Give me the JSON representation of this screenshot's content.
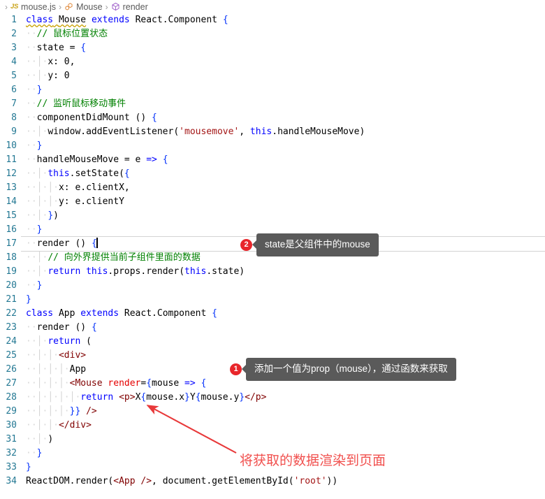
{
  "breadcrumb": {
    "items": [
      {
        "icon": "js-file-icon",
        "label": "mouse.js"
      },
      {
        "icon": "class-symbol-icon",
        "label": "Mouse"
      },
      {
        "icon": "method-symbol-icon",
        "label": "render"
      }
    ],
    "separator": "›"
  },
  "editor": {
    "language": "javascript",
    "current_line": 17,
    "lines": [
      {
        "n": "1",
        "text": "class Mouse extends React.Component {"
      },
      {
        "n": "2",
        "text": "  // 鼠标位置状态"
      },
      {
        "n": "3",
        "text": "  state = {"
      },
      {
        "n": "4",
        "text": "    x: 0,"
      },
      {
        "n": "5",
        "text": "    y: 0"
      },
      {
        "n": "6",
        "text": "  }"
      },
      {
        "n": "7",
        "text": "  // 监听鼠标移动事件"
      },
      {
        "n": "8",
        "text": "  componentDidMount () {"
      },
      {
        "n": "9",
        "text": "    window.addEventListener('mousemove', this.handleMouseMove)"
      },
      {
        "n": "10",
        "text": "  }"
      },
      {
        "n": "11",
        "text": "  handleMouseMove = e => {"
      },
      {
        "n": "12",
        "text": "    this.setState({"
      },
      {
        "n": "13",
        "text": "      x: e.clientX,"
      },
      {
        "n": "14",
        "text": "      y: e.clientY"
      },
      {
        "n": "15",
        "text": "    })"
      },
      {
        "n": "16",
        "text": "  }"
      },
      {
        "n": "17",
        "text": "  render () {"
      },
      {
        "n": "18",
        "text": "    // 向外界提供当前子组件里面的数据"
      },
      {
        "n": "19",
        "text": "    return this.props.render(this.state)"
      },
      {
        "n": "20",
        "text": "  }"
      },
      {
        "n": "21",
        "text": "}"
      },
      {
        "n": "22",
        "text": "class App extends React.Component {"
      },
      {
        "n": "23",
        "text": "  render () {"
      },
      {
        "n": "24",
        "text": "    return ("
      },
      {
        "n": "25",
        "text": "      <div>"
      },
      {
        "n": "26",
        "text": "        App"
      },
      {
        "n": "27",
        "text": "        <Mouse render={mouse => {"
      },
      {
        "n": "28",
        "text": "          return <p>X{mouse.x}Y{mouse.y}</p>"
      },
      {
        "n": "29",
        "text": "        }} />"
      },
      {
        "n": "30",
        "text": "      </div>"
      },
      {
        "n": "31",
        "text": "    )"
      },
      {
        "n": "32",
        "text": "  }"
      },
      {
        "n": "33",
        "text": "}"
      },
      {
        "n": "34",
        "text": "ReactDOM.render(<App />, document.getElementById('root'))"
      }
    ]
  },
  "annotations": {
    "tooltips": [
      {
        "number": "2",
        "text": "state是父组件中的mouse"
      },
      {
        "number": "1",
        "text": "添加一个值为prop（mouse），通过函数来获取"
      }
    ],
    "red_note": "将获取的数据渲染到页面"
  },
  "colors": {
    "badge_red": "#e8262b",
    "bubble_gray": "#5a5a5a",
    "arrow_red": "#e8393a",
    "note_red": "#f1504e",
    "keyword_blue": "#0000ff",
    "string_red": "#a31515",
    "comment_green": "#008000",
    "gutter_blue": "#237893",
    "tag_maroon": "#800000"
  }
}
